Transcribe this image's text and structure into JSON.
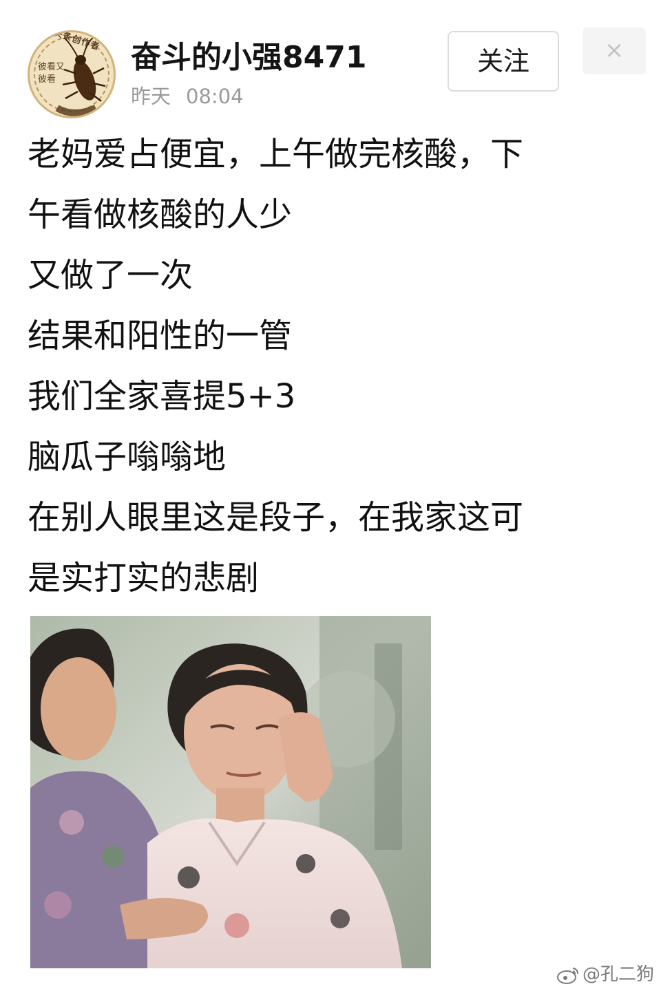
{
  "header": {
    "avatar_badge": "头条创作者",
    "avatar_side_text": "彼看又彼看",
    "username": "奋斗的小强8471",
    "date_label": "昨天",
    "time": "08:04",
    "follow_label": "关注",
    "close_symbol": "×"
  },
  "post": {
    "lines": [
      "老妈爱占便宜，上午做完核酸，下",
      "午看做核酸的人少",
      "又做了一次",
      "结果和阳性的一管",
      "我们全家喜提5+3",
      "脑瓜子嗡嗡地",
      "在别人眼里这是段子，在我家这可",
      "是实打实的悲剧"
    ]
  },
  "watermark": {
    "text": "@孔二狗",
    "icon": "weibo-icon"
  },
  "colors": {
    "username": "#141414",
    "time": "#9a9a9a",
    "follow_border": "#dcdcdc",
    "close_bg": "#f4f4f4"
  }
}
